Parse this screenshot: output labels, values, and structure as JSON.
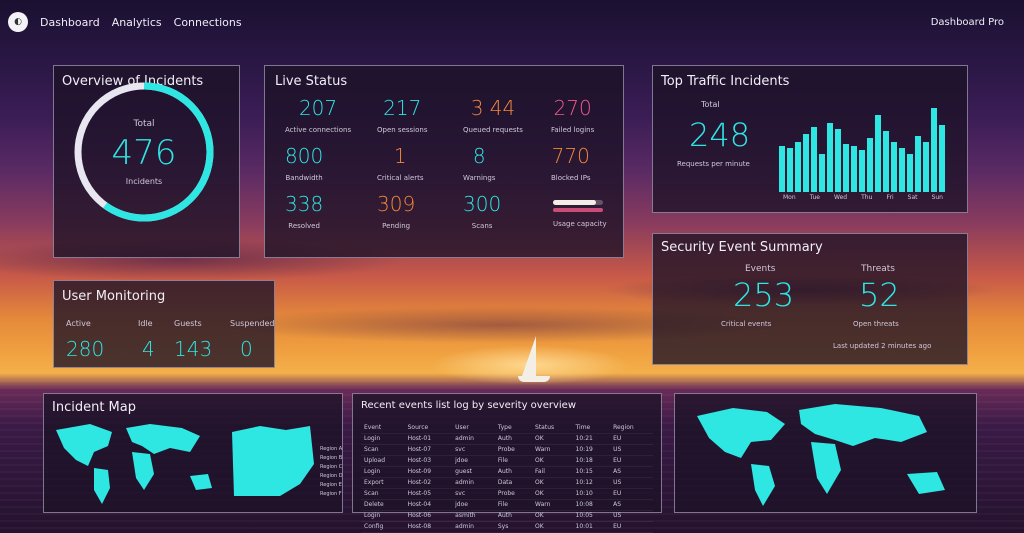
{
  "header": {
    "logo_glyph": "◐",
    "nav": [
      "Dashboard",
      "Analytics",
      "Connections"
    ],
    "user": "Dashboard Pro"
  },
  "overview": {
    "title": "Overview of Incidents",
    "center_label": "Total",
    "value": "476",
    "sub_label": "Incidents",
    "progress": 0.6
  },
  "live_status": {
    "title": "Live Status",
    "items": [
      {
        "value": "207",
        "label": "Active connections",
        "color": "cyan"
      },
      {
        "value": "217",
        "label": "Open sessions",
        "color": "cyan"
      },
      {
        "value": "3 44",
        "label": "Queued requests",
        "color": "orange"
      },
      {
        "value": "270",
        "label": "Failed logins",
        "color": "pink"
      },
      {
        "value": "800",
        "label": "Bandwidth",
        "color": "cyan"
      },
      {
        "value": "1",
        "label": "Critical alerts",
        "color": "orange"
      },
      {
        "value": "8",
        "label": "Warnings",
        "color": "cyan"
      },
      {
        "value": "770",
        "label": "Blocked IPs",
        "color": "orange"
      },
      {
        "value": "338",
        "label": "Resolved",
        "color": "cyan"
      },
      {
        "value": "309",
        "label": "Pending",
        "color": "orange"
      },
      {
        "value": "300",
        "label": "Scans",
        "color": "cyan"
      }
    ],
    "progress_label": "Usage capacity",
    "progress_fill": 0.85
  },
  "traffic": {
    "title": "Top Traffic Incidents",
    "small_label": "Total",
    "value": "248",
    "sub_label": "Requests per minute",
    "chart_data": {
      "type": "bar",
      "values": [
        48,
        46,
        52,
        60,
        68,
        40,
        72,
        66,
        50,
        48,
        44,
        56,
        80,
        64,
        52,
        46,
        40,
        58,
        52,
        88,
        70
      ],
      "categories": [
        "Mon",
        "Tue",
        "Wed",
        "Thu",
        "Fri",
        "Sat",
        "Sun"
      ],
      "ylim": [
        0,
        100
      ]
    }
  },
  "security": {
    "title": "Security Event Summary",
    "left": {
      "label": "Events",
      "value": "253",
      "sub": "Critical events"
    },
    "right": {
      "label": "Threats",
      "value": "52",
      "sub": "Open threats"
    },
    "footer": "Last updated 2 minutes ago"
  },
  "user_monitoring": {
    "title": "User Monitoring",
    "cols": [
      {
        "label": "Active",
        "value": "280"
      },
      {
        "label": "Idle",
        "value": "4"
      },
      {
        "label": "Guests",
        "value": "143"
      },
      {
        "label": "Suspended",
        "value": "0"
      }
    ]
  },
  "incidents_map": {
    "title": "Incident Map",
    "legend": [
      "Region A",
      "Region B",
      "Region C",
      "Region D",
      "Region E",
      "Region F"
    ]
  },
  "table": {
    "title": "Recent events list log by severity overview",
    "rows": [
      [
        "Event",
        "Source",
        "User",
        "Type",
        "Status",
        "Time",
        "Region"
      ],
      [
        "Login",
        "Host-01",
        "admin",
        "Auth",
        "OK",
        "10:21",
        "EU"
      ],
      [
        "Scan",
        "Host-07",
        "svc",
        "Probe",
        "Warn",
        "10:19",
        "US"
      ],
      [
        "Upload",
        "Host-03",
        "jdoe",
        "File",
        "OK",
        "10:18",
        "EU"
      ],
      [
        "Login",
        "Host-09",
        "guest",
        "Auth",
        "Fail",
        "10:15",
        "AS"
      ],
      [
        "Export",
        "Host-02",
        "admin",
        "Data",
        "OK",
        "10:12",
        "US"
      ],
      [
        "Scan",
        "Host-05",
        "svc",
        "Probe",
        "OK",
        "10:10",
        "EU"
      ],
      [
        "Delete",
        "Host-04",
        "jdoe",
        "File",
        "Warn",
        "10:08",
        "AS"
      ],
      [
        "Login",
        "Host-06",
        "asmith",
        "Auth",
        "OK",
        "10:05",
        "US"
      ],
      [
        "Config",
        "Host-08",
        "admin",
        "Sys",
        "OK",
        "10:01",
        "EU"
      ]
    ]
  },
  "colors": {
    "accent": "#2ee6e2",
    "orange": "#f2873a",
    "pink": "#f05a8a",
    "panel": "#1c1226"
  }
}
